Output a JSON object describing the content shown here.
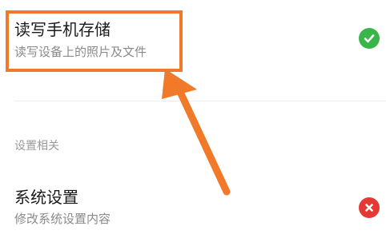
{
  "permissions": [
    {
      "title": "读写手机存储",
      "subtitle": "读写设备上的照片及文件",
      "status": "allowed",
      "status_icon": "check-icon",
      "status_color": "#39b54a"
    }
  ],
  "section": {
    "header": "设置相关",
    "items": [
      {
        "title": "系统设置",
        "subtitle": "修改系统设置内容",
        "status": "denied",
        "status_icon": "close-icon",
        "status_color": "#e53935"
      }
    ]
  },
  "annotation": {
    "highlight_color": "#f07a2a",
    "arrow_color": "#f07a2a"
  }
}
